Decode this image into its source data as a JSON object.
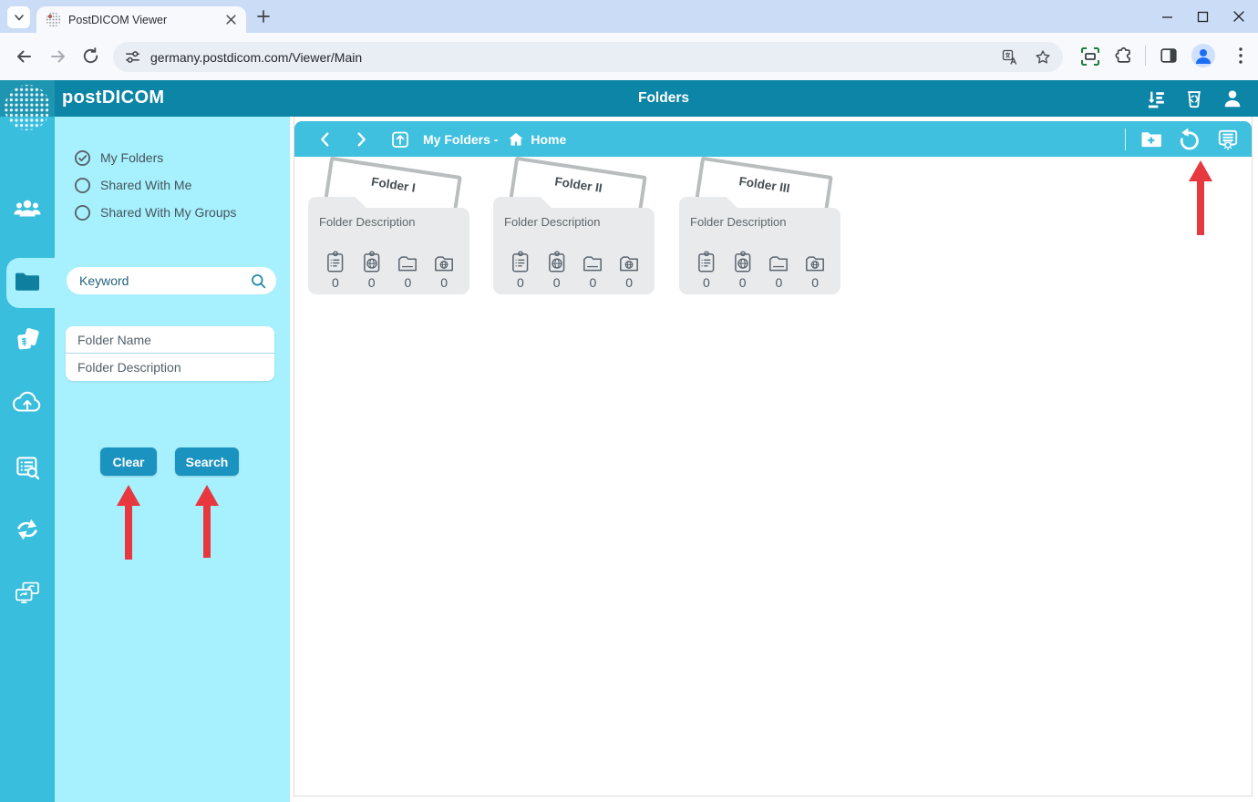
{
  "browser": {
    "tab_title": "PostDICOM Viewer",
    "url": "germany.postdicom.com/Viewer/Main"
  },
  "topbar": {
    "logo_text": "postDICOM",
    "title": "Folders"
  },
  "breadcrumb": {
    "prefix": "My Folders - ",
    "home_label": "Home"
  },
  "filters": {
    "options": [
      {
        "label": "My Folders",
        "selected": true
      },
      {
        "label": "Shared With Me",
        "selected": false
      },
      {
        "label": "Shared With My Groups",
        "selected": false
      }
    ],
    "keyword_placeholder": "Keyword",
    "folder_name_placeholder": "Folder Name",
    "folder_description_placeholder": "Folder Description",
    "clear_label": "Clear",
    "search_label": "Search"
  },
  "folders": [
    {
      "name": "Folder I",
      "description": "Folder Description",
      "counts": [
        "0",
        "0",
        "0",
        "0"
      ]
    },
    {
      "name": "Folder II",
      "description": "Folder Description",
      "counts": [
        "0",
        "0",
        "0",
        "0"
      ]
    },
    {
      "name": "Folder III",
      "description": "Folder Description",
      "counts": [
        "0",
        "0",
        "0",
        "0"
      ]
    }
  ],
  "icons": {
    "topbar": [
      "sort-queue-icon",
      "recycle-bin-icon",
      "user-icon"
    ],
    "sidebar": [
      "patients-icon",
      "folders-icon",
      "studies-icon",
      "cloud-upload-icon",
      "worklist-search-icon",
      "transfer-icon",
      "share-screens-icon"
    ],
    "breadcrumb_actions": [
      "new-folder-icon",
      "refresh-icon",
      "folder-settings-icon"
    ],
    "folder_card_stats": [
      "clipboard-list-icon",
      "clipboard-dicom-icon",
      "subfolder-icon",
      "folder-dicom-icon"
    ]
  },
  "colors": {
    "topbar": "#0d85a6",
    "sidebar": "#39bedd",
    "panel": "#a7f0fe",
    "breadcrumb_bar": "#40c0df",
    "button": "#1b93c0",
    "annotation_arrow_red": "#e8383f",
    "folder_card_gray": "#e9eaeb"
  }
}
